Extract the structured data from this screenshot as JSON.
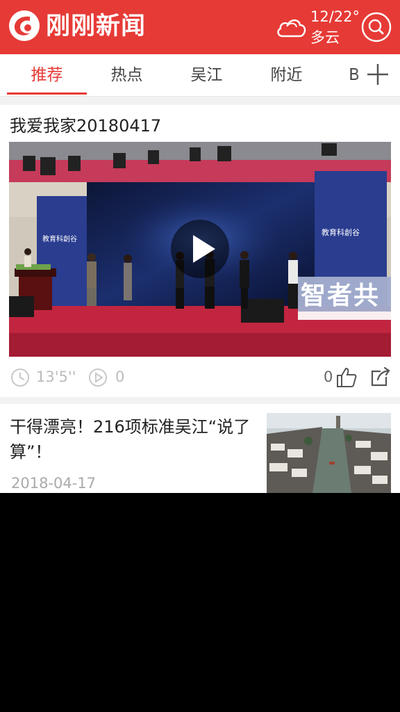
{
  "header": {
    "brand": "刚刚新闻",
    "temperature": "12/22°",
    "condition": "多云",
    "brand_color": "#e63a36"
  },
  "tabs": [
    {
      "label": "推荐",
      "active": true
    },
    {
      "label": "热点",
      "active": false
    },
    {
      "label": "吴江",
      "active": false
    },
    {
      "label": "附近",
      "active": false
    },
    {
      "label": "B",
      "active": false
    }
  ],
  "video_card": {
    "title": "我爱我家20180417",
    "duration": "13'5''",
    "play_count": "0",
    "like_count": "0",
    "banner_text": "智者共",
    "screen_logo_left": "教育科創谷",
    "screen_logo_right": "教育科創谷"
  },
  "article_card": {
    "title": "干得漂亮！216项标准吴江“说了算”！",
    "date": "2018-04-17"
  }
}
